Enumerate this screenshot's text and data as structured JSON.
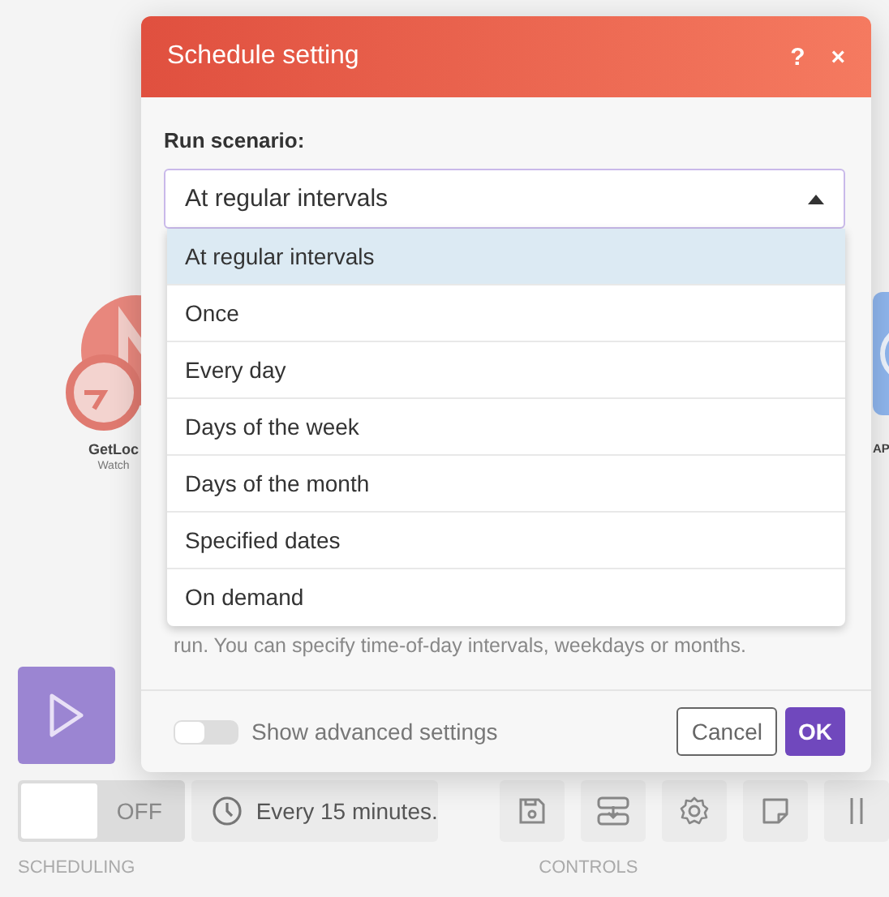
{
  "canvas": {
    "modules": [
      {
        "kind": "clock-app",
        "name": "GetLoc",
        "subtitle": "Watch"
      },
      {
        "kind": "globe-app",
        "name": "AP"
      }
    ]
  },
  "dialog": {
    "title": "Schedule setting",
    "help": "?",
    "close": "×",
    "field_label": "Run scenario:",
    "value": "At regular intervals",
    "options": [
      {
        "label": "At regular intervals",
        "selected": true
      },
      {
        "label": "Once",
        "selected": false
      },
      {
        "label": "Every day",
        "selected": false
      },
      {
        "label": "Days of the week",
        "selected": false
      },
      {
        "label": "Days of the month",
        "selected": false
      },
      {
        "label": "Specified dates",
        "selected": false
      },
      {
        "label": "On demand",
        "selected": false
      }
    ],
    "hint": "run. You can specify time-of-day intervals, weekdays or months.",
    "advanced": {
      "label": "Show advanced settings",
      "on": false
    },
    "buttons": [
      {
        "kind": "secondary",
        "label": "Cancel"
      },
      {
        "kind": "primary",
        "label": "OK"
      }
    ]
  },
  "toolbar": {
    "scheduling": {
      "on": false,
      "label": "OFF"
    },
    "schedule": "Every 15 minutes.",
    "sections": [
      "SCHEDULING",
      "CONTROLS"
    ],
    "controls": [
      {
        "kind": "save"
      },
      {
        "kind": "import"
      },
      {
        "kind": "settings"
      },
      {
        "kind": "note"
      },
      {
        "kind": "align"
      }
    ]
  }
}
